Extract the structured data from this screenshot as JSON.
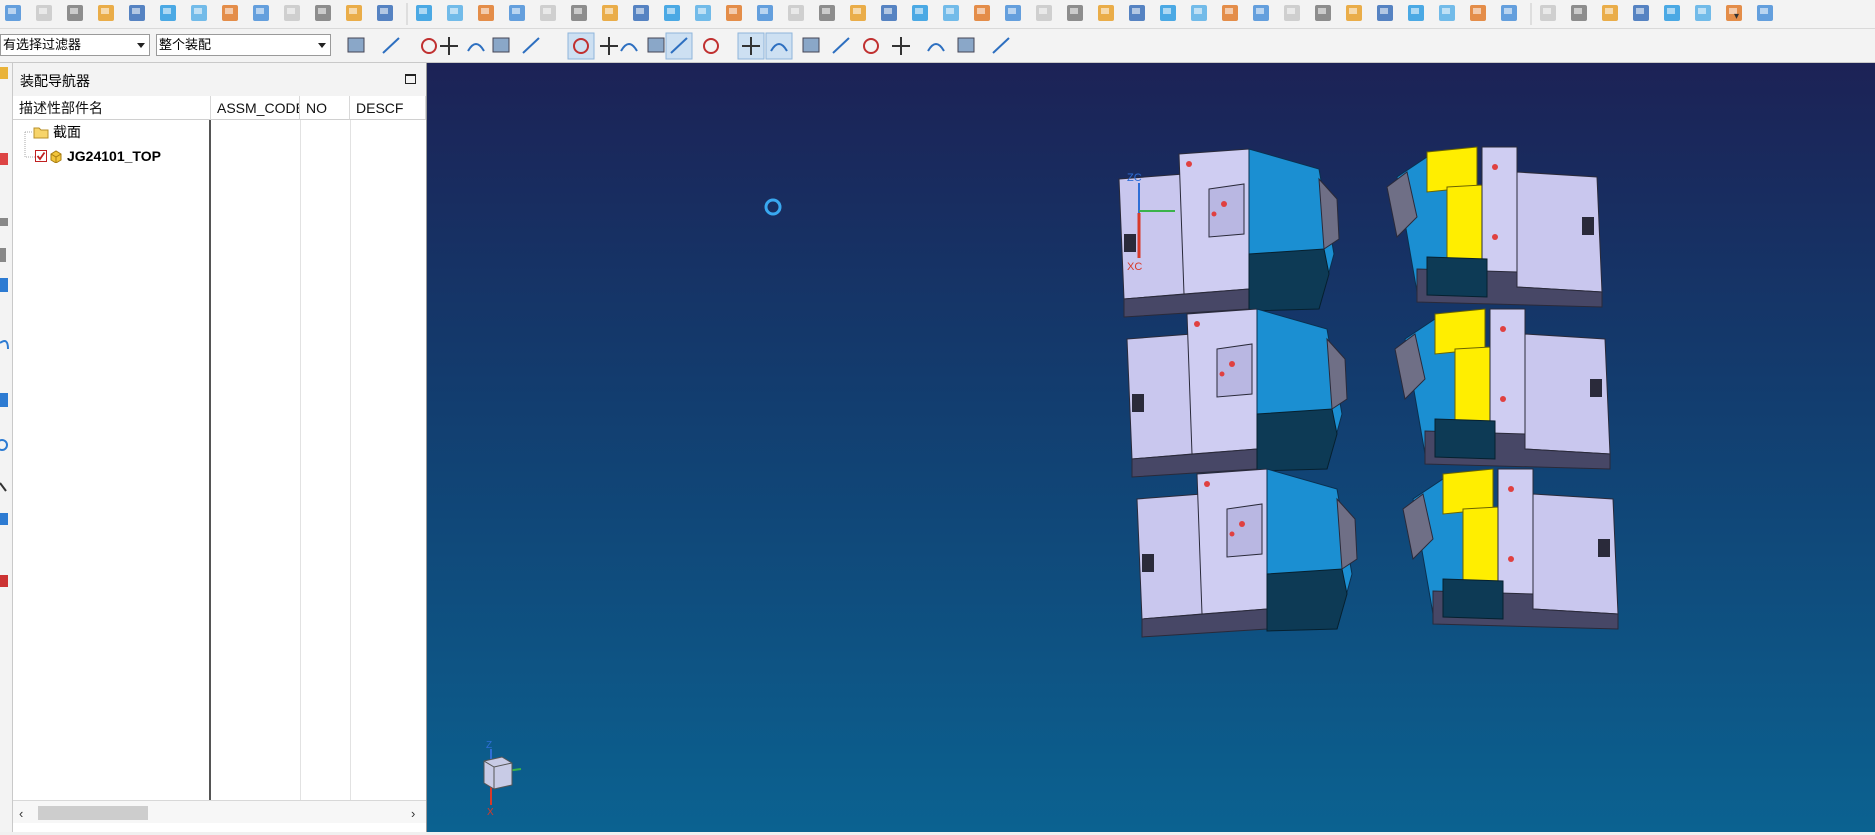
{
  "filters": {
    "selection_filter": "有选择过滤器",
    "scope": "整个装配"
  },
  "navigator": {
    "title": "装配导航器",
    "columns": [
      "描述性部件名",
      "ASSM_CODE",
      "NO",
      "DESCF"
    ],
    "rows": [
      {
        "label": "截面",
        "icon": "folder-icon"
      },
      {
        "label": "JG24101_TOP",
        "icon": "assembly-icon",
        "checked": true
      }
    ]
  },
  "viewport": {
    "wcs_labels": {
      "zc": "ZC",
      "xc": "XC"
    },
    "triad_labels": {
      "z": "Z",
      "x": "X"
    }
  },
  "colors": {
    "viewport_top": "#1c2256",
    "viewport_bottom": "#0b6291",
    "part_blue": "#1b8fd2",
    "part_yellow": "#ffee00",
    "part_lavender": "#c9c7ee"
  }
}
